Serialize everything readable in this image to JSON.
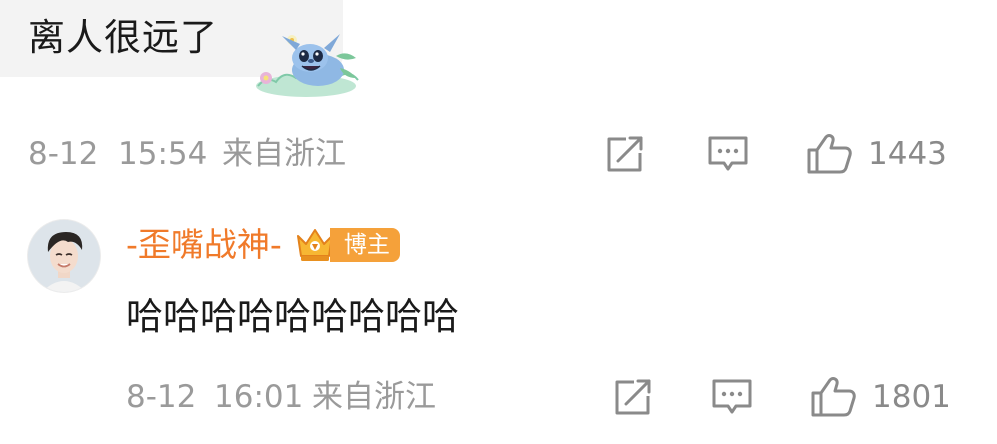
{
  "comments": [
    {
      "text": "离人很远了",
      "sticker": "stitch-sticker",
      "meta": {
        "date": "8-12",
        "time": "15:54",
        "location": "来自浙江"
      },
      "actions": {
        "share_icon": "share-icon",
        "reply_icon": "comment-icon",
        "like_icon": "thumbs-up-icon",
        "like_count": "1443"
      }
    },
    {
      "avatar": "user-avatar",
      "username": "-歪嘴战神-",
      "badge_icon": "crown-icon",
      "badge_label": "博主",
      "text": "哈哈哈哈哈哈哈哈哈",
      "meta": {
        "date": "8-12",
        "time": "16:01",
        "location": "来自浙江"
      },
      "actions": {
        "share_icon": "share-icon",
        "reply_icon": "comment-icon",
        "like_icon": "thumbs-up-icon",
        "like_count": "1801"
      }
    }
  ],
  "colors": {
    "username": "#f07a2a",
    "badge": "#f5a13a",
    "meta_text": "#9a9a9a",
    "body_text": "#1a1a1a",
    "bubble_bg": "#f3f3f3"
  }
}
